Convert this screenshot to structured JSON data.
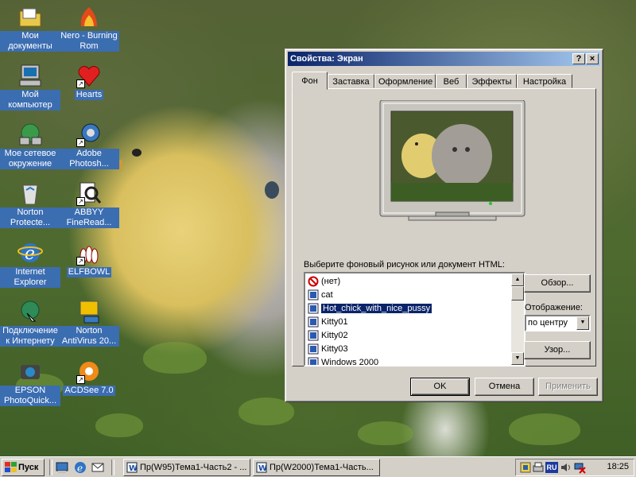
{
  "desktop": {
    "icons": [
      {
        "label": "Мои документы",
        "icon": "my-documents-icon"
      },
      {
        "label": "Nero - Burning Rom",
        "icon": "nero-icon"
      },
      {
        "label": "Мой компьютер",
        "icon": "my-computer-icon"
      },
      {
        "label": "Hearts",
        "icon": "hearts-icon"
      },
      {
        "label": "Мое сетевое окружение",
        "icon": "network-icon"
      },
      {
        "label": "Adobe Photosh...",
        "icon": "photoshop-icon"
      },
      {
        "label": "Norton Protecte...",
        "icon": "recycle-bin-icon"
      },
      {
        "label": "ABBYY FineRead...",
        "icon": "finereader-icon"
      },
      {
        "label": "Internet Explorer",
        "icon": "internet-explorer-icon"
      },
      {
        "label": "ELFBOWL",
        "icon": "elfbowl-icon"
      },
      {
        "label": "Подключение к Интернету",
        "icon": "connect-internet-icon"
      },
      {
        "label": "Norton AntiVirus 20...",
        "icon": "norton-antivirus-icon"
      },
      {
        "label": "EPSON PhotoQuick...",
        "icon": "epson-icon"
      },
      {
        "label": "ACDSee 7.0",
        "icon": "acdsee-icon"
      }
    ]
  },
  "dialog": {
    "title": "Свойства: Экран",
    "help_button": "?",
    "close_button": "×",
    "tabs": [
      "Фон",
      "Заставка",
      "Оформление",
      "Веб",
      "Эффекты",
      "Настройка"
    ],
    "active_tab": "Фон",
    "list_label": "Выберите фоновый рисунок или документ HTML:",
    "list_items": [
      {
        "label": "(нет)",
        "icon": "none-icon"
      },
      {
        "label": "cat",
        "icon": "bitmap-icon"
      },
      {
        "label": "Hot_chick_with_nice_pussy",
        "icon": "bitmap-icon",
        "selected": true
      },
      {
        "label": "Kitty01",
        "icon": "bitmap-icon"
      },
      {
        "label": "Kitty02",
        "icon": "bitmap-icon"
      },
      {
        "label": "Kitty03",
        "icon": "bitmap-icon"
      },
      {
        "label": "Windows 2000",
        "icon": "bitmap-icon"
      }
    ],
    "browse_button": "Обзор...",
    "display_label": "Отображение:",
    "display_value": "по центру",
    "pattern_button": "Узор...",
    "ok_button": "OK",
    "cancel_button": "Отмена",
    "apply_button": "Применить"
  },
  "taskbar": {
    "start_label": "Пуск",
    "windows": [
      {
        "label": "Пр(W95)Тема1-Часть2 - ..."
      },
      {
        "label": "Пр(W2000)Тема1-Часть..."
      }
    ],
    "tray": {
      "language": "RU",
      "clock": "18:25"
    }
  }
}
